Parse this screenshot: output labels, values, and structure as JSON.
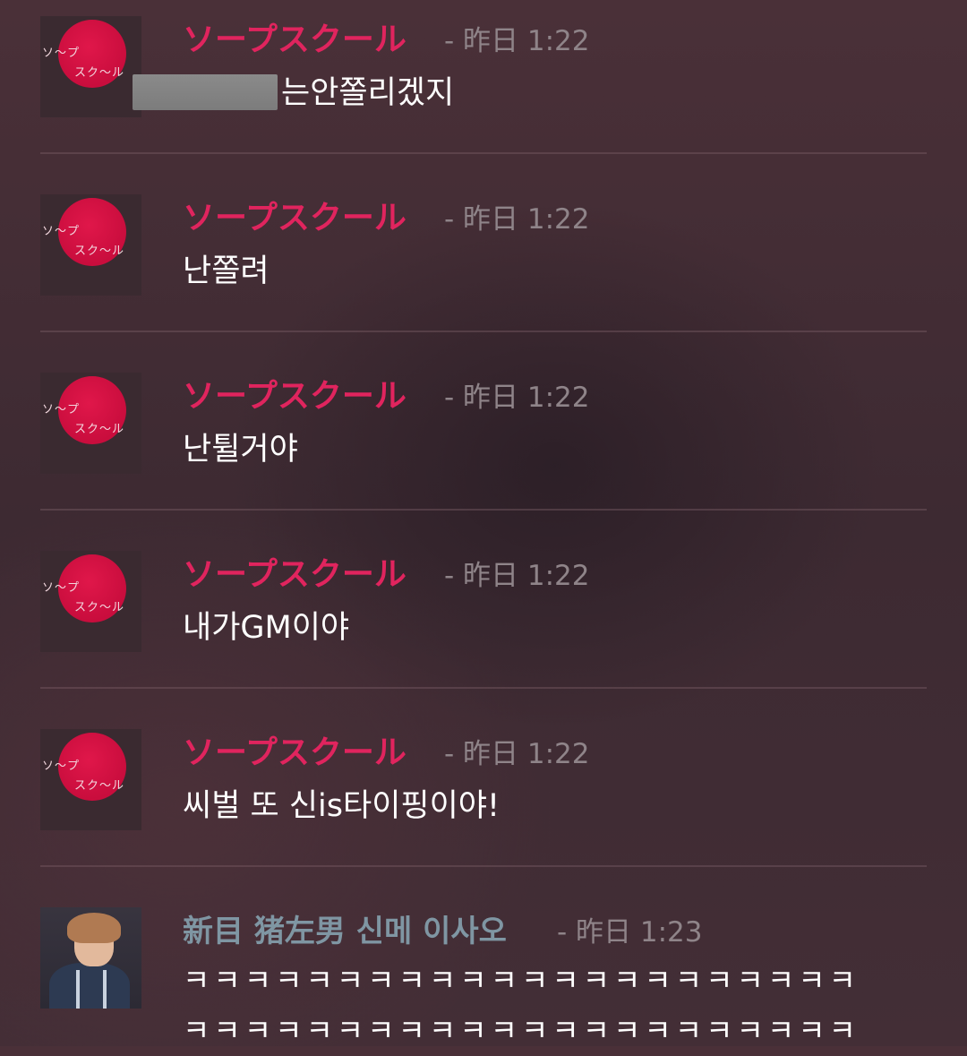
{
  "messages": [
    {
      "author": "ソープスクール",
      "meta": "- 昨日 1:22",
      "text": "는안쫄리겠지",
      "avatar": "soap-school-logo"
    },
    {
      "author": "ソープスクール",
      "meta": "- 昨日 1:22",
      "text": "난쫄려",
      "avatar": "soap-school-logo"
    },
    {
      "author": "ソープスクール",
      "meta": "- 昨日 1:22",
      "text": "난튈거야",
      "avatar": "soap-school-logo"
    },
    {
      "author": "ソープスクール",
      "meta": "- 昨日 1:22",
      "text": "내가GM이야",
      "avatar": "soap-school-logo"
    },
    {
      "author": "ソープスクール",
      "meta": "- 昨日 1:22",
      "text": "씨벌 또 신is타이핑이야!",
      "avatar": "soap-school-logo"
    },
    {
      "author": "新目 猪左男 신메 이사오",
      "meta": "- 昨日 1:23",
      "line1": "ㅋㅋㅋㅋㅋㅋㅋㅋㅋㅋㅋㅋㅋㅋㅋㅋㅋㅋㅋㅋㅋㅋ",
      "line2": "ㅋㅋㅋㅋㅋㅋㅋㅋㅋㅋㅋㅋㅋㅋㅋㅋㅋㅋㅋㅋㅋㅋ",
      "avatar": "anime-portrait"
    }
  ],
  "logo": {
    "line1": "ソ〜プ",
    "line2": "スク〜ル"
  },
  "colors": {
    "author_pink": "#e0245e",
    "author_gray": "#7f96a3",
    "meta": "#8f8489",
    "text": "#ffffff"
  }
}
